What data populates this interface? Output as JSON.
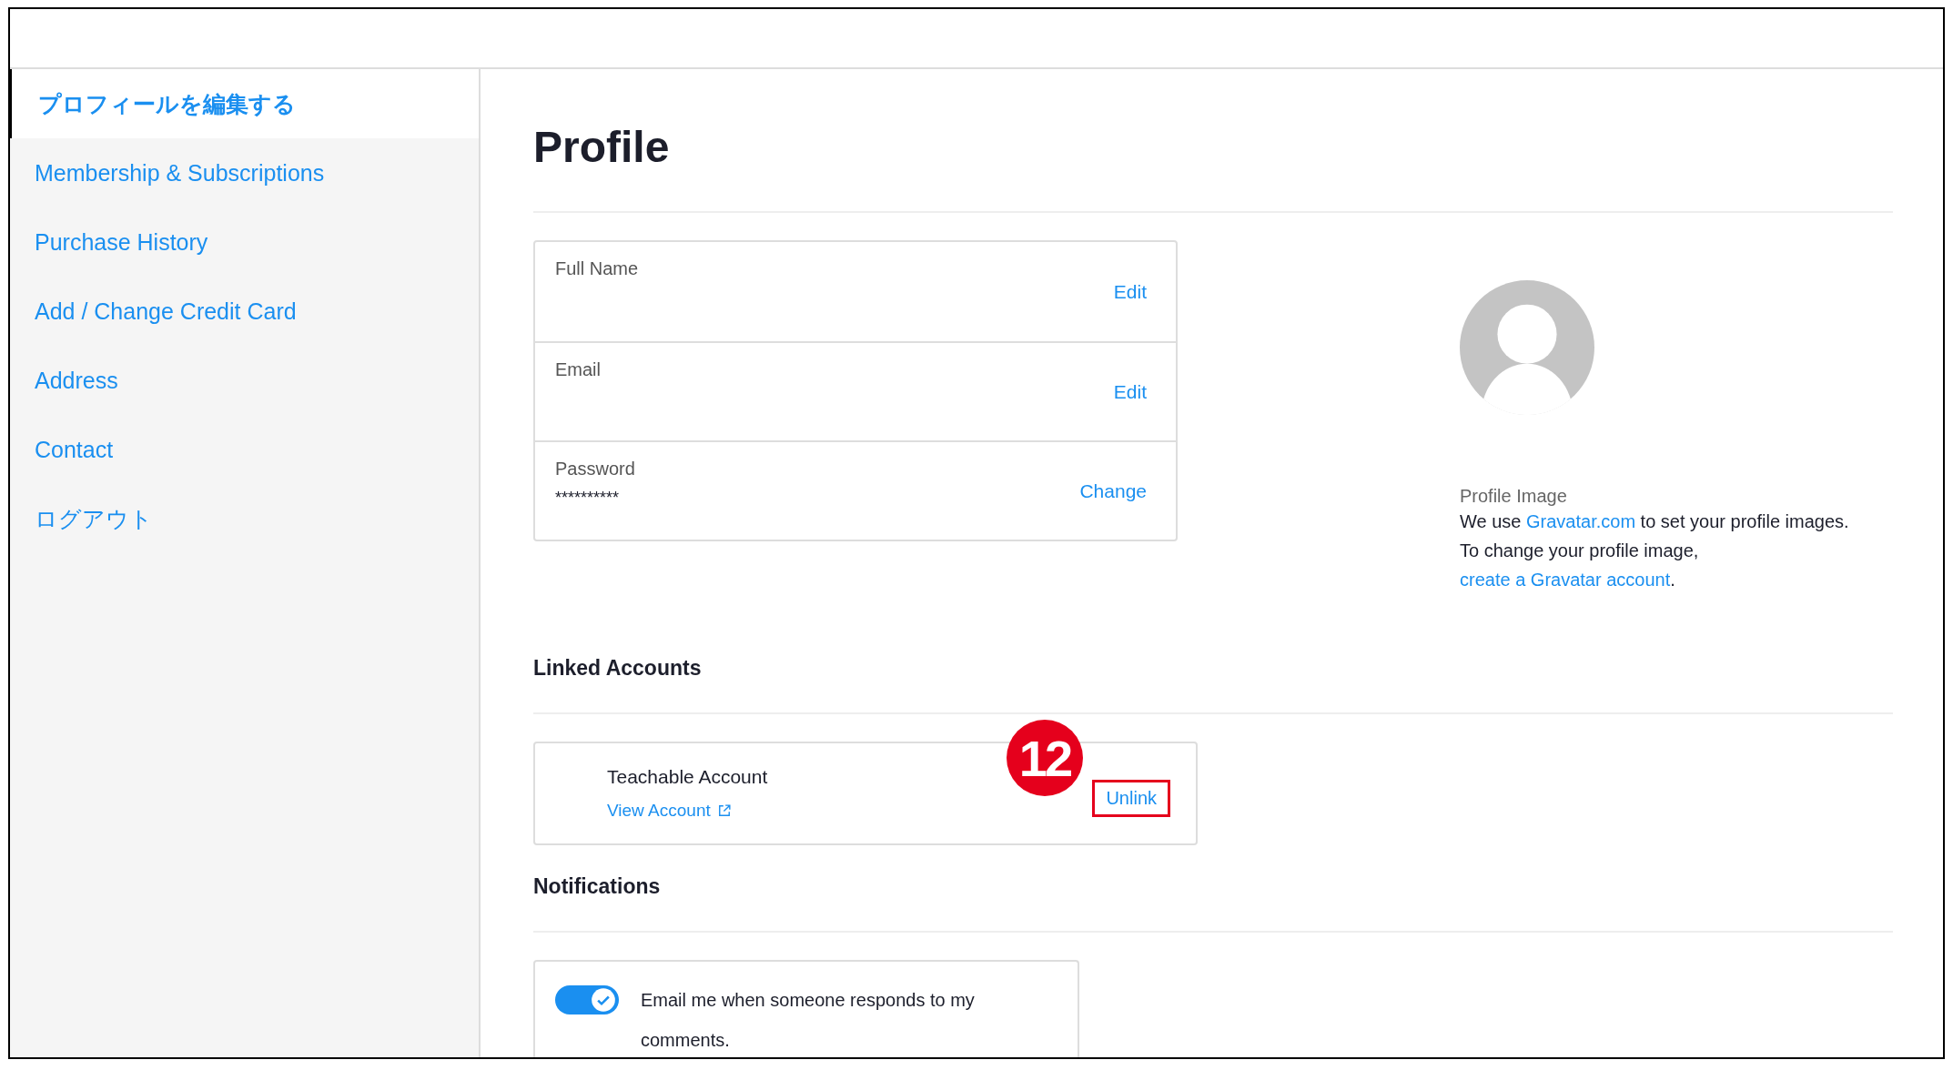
{
  "sidebar": {
    "items": [
      {
        "label": "プロフィールを編集する",
        "selected": true
      },
      {
        "label": "Membership & Subscriptions",
        "selected": false
      },
      {
        "label": "Purchase History",
        "selected": false
      },
      {
        "label": "Add / Change Credit Card",
        "selected": false
      },
      {
        "label": "Address",
        "selected": false
      },
      {
        "label": "Contact",
        "selected": false
      },
      {
        "label": "ログアウト",
        "selected": false
      }
    ]
  },
  "page_title": "Profile",
  "profile_fields": [
    {
      "label": "Full Name",
      "action": "Edit"
    },
    {
      "label": "Email",
      "action": "Edit"
    },
    {
      "label": "Password",
      "value": "**********",
      "action": "Change"
    }
  ],
  "profile_image": {
    "label": "Profile Image",
    "paragraphs": [
      [
        {
          "kind": "text",
          "text": "We use "
        },
        {
          "kind": "link",
          "text": "Gravatar.com"
        },
        {
          "kind": "text",
          "text": " to set your profile images."
        }
      ],
      [
        {
          "kind": "text",
          "text": "To change your profile image, "
        },
        {
          "kind": "link",
          "text": "create a Gravatar account"
        },
        {
          "kind": "text",
          "text": "."
        }
      ]
    ]
  },
  "linked_accounts": {
    "heading": "Linked Accounts",
    "accounts": [
      {
        "name": "Teachable Account",
        "link": "View Account",
        "action": "Unlink",
        "highlighted": true,
        "callout": "12"
      }
    ]
  },
  "notifications": {
    "heading": "Notifications",
    "options": [
      {
        "label": "Email me when someone responds to my comments.",
        "on": true
      }
    ]
  }
}
